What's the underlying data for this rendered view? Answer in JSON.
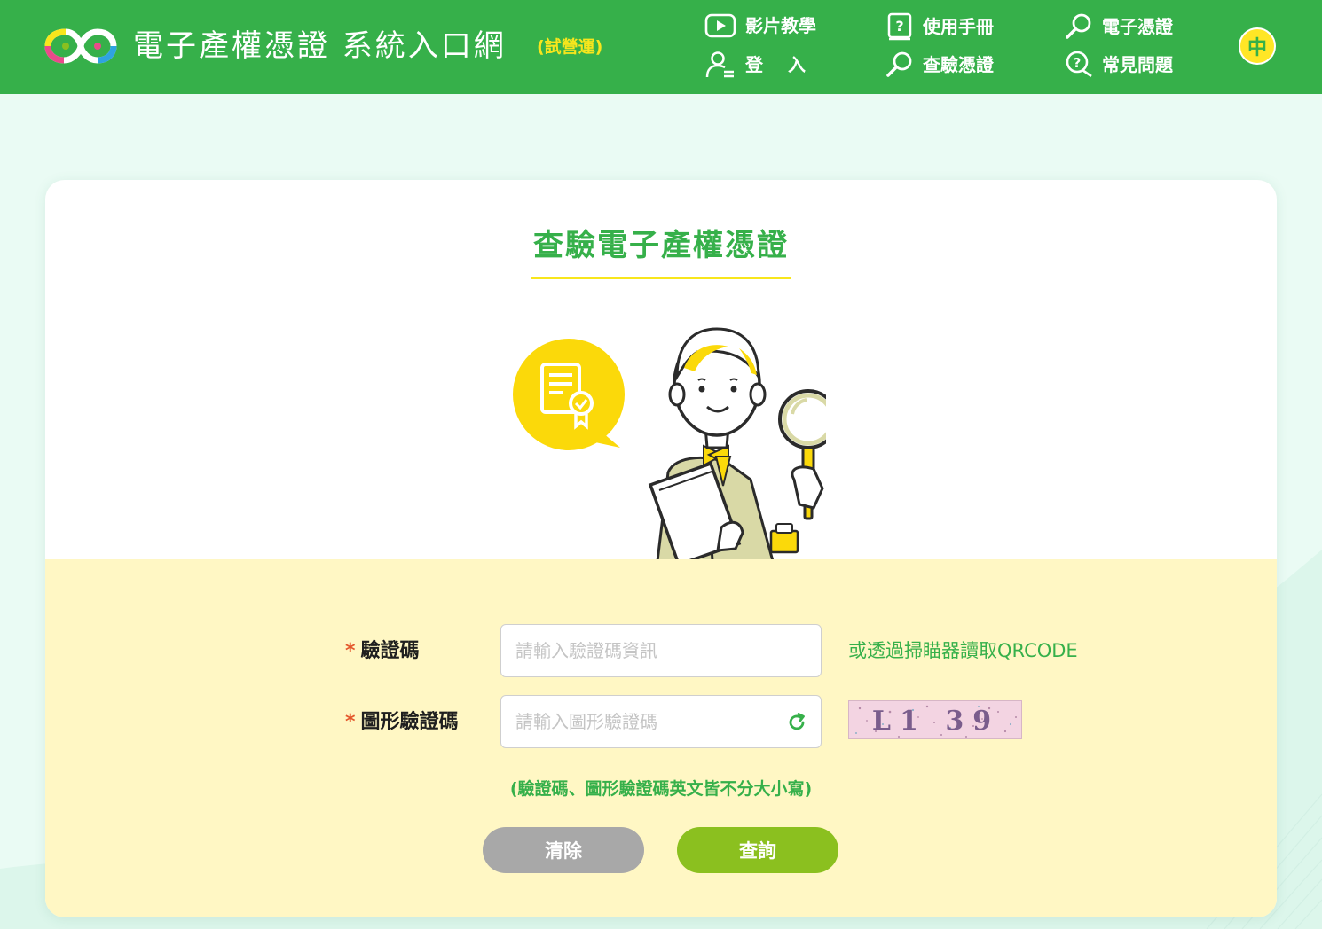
{
  "header": {
    "site_title": "電子產權憑證 系統入口網",
    "badge": "(試營運)",
    "nav": {
      "video": "影片教學",
      "login": "登入",
      "manual": "使用手冊",
      "verify": "查驗憑證",
      "certificate": "電子憑證",
      "faq": "常見問題"
    },
    "lang_button": "中"
  },
  "card": {
    "title": "查驗電子產權憑證"
  },
  "form": {
    "code_label": "驗證碼",
    "code_placeholder": "請輸入驗證碼資訊",
    "qr_hint": "或透過掃瞄器讀取QRCODE",
    "captcha_label": "圖形驗證碼",
    "captcha_placeholder": "請輸入圖形驗證碼",
    "captcha_text": "L1 39",
    "required_mark": "*",
    "case_hint": "(驗證碼、圖形驗證碼英文皆不分大小寫)",
    "clear_button": "清除",
    "query_button": "查詢"
  },
  "colors": {
    "header_green": "#36b04a",
    "accent_yellow": "#f8e61c",
    "form_bg": "#fff7c4",
    "query_green": "#8bc01f",
    "clear_gray": "#a8a8a8",
    "required_red": "#e4582c"
  }
}
